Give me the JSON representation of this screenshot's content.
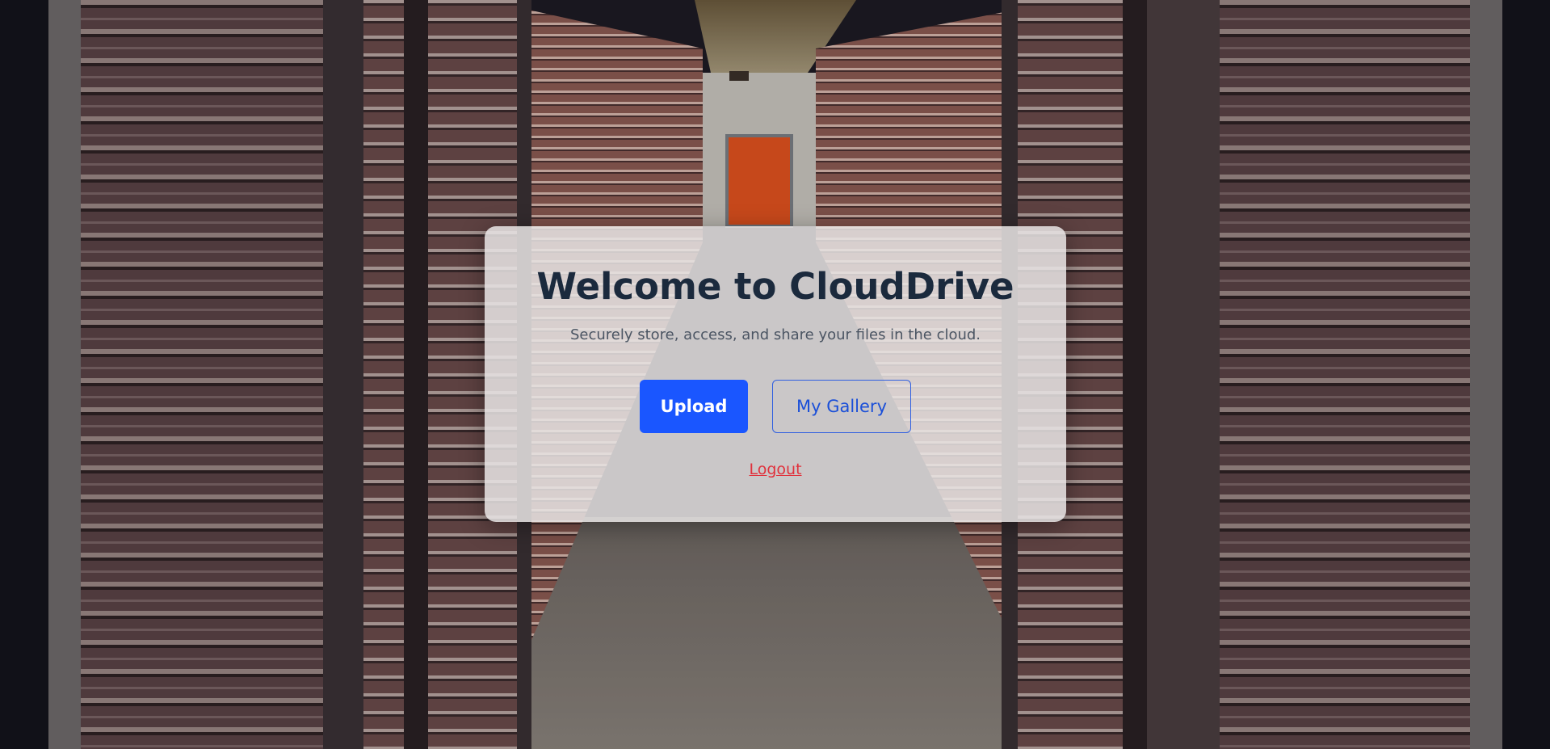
{
  "page": {
    "background": "storage-unit-hallway-photo"
  },
  "card": {
    "title": "Welcome to CloudDrive",
    "subtitle": "Securely store, access, and share your files in the cloud."
  },
  "actions": {
    "upload_label": "Upload",
    "gallery_label": "My Gallery",
    "logout_label": "Logout"
  },
  "colors": {
    "primary": "#1a56ff",
    "secondary_text": "#1a4fd8",
    "logout": "#e0313c",
    "title": "#1b2a3d"
  }
}
